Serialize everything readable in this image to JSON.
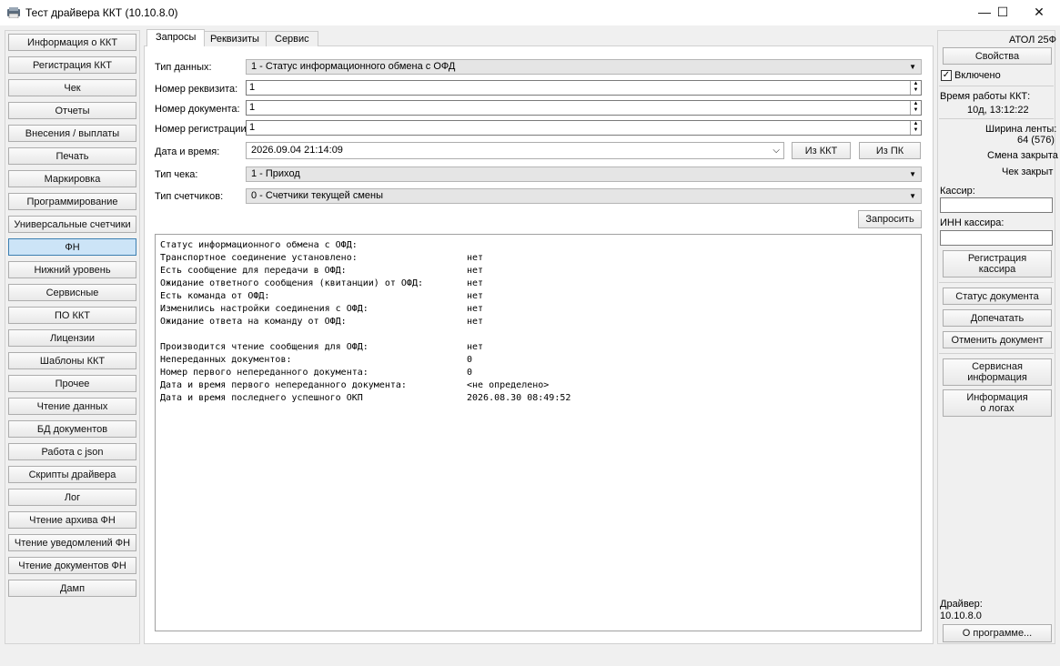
{
  "window": {
    "title": "Тест драйвера ККТ (10.10.8.0)",
    "minimize_glyph": "—",
    "maximize_glyph": "☐",
    "close_glyph": "✕"
  },
  "sidebar": {
    "items": [
      {
        "label": "Информация о ККТ"
      },
      {
        "label": "Регистрация ККТ"
      },
      {
        "label": "Чек"
      },
      {
        "label": "Отчеты"
      },
      {
        "label": "Внесения / выплаты"
      },
      {
        "label": "Печать"
      },
      {
        "label": "Маркировка"
      },
      {
        "label": "Программирование"
      },
      {
        "label": "Универсальные счетчики"
      },
      {
        "label": "ФН",
        "selected": true
      },
      {
        "label": "Нижний уровень"
      },
      {
        "label": "Сервисные"
      },
      {
        "label": "ПО ККТ"
      },
      {
        "label": "Лицензии"
      },
      {
        "label": "Шаблоны ККТ"
      },
      {
        "label": "Прочее"
      },
      {
        "label": "Чтение данных"
      },
      {
        "label": "БД документов"
      },
      {
        "label": "Работа с json"
      },
      {
        "label": "Скрипты драйвера"
      },
      {
        "label": "Лог"
      },
      {
        "label": "Чтение архива ФН"
      },
      {
        "label": "Чтение уведомлений ФН"
      },
      {
        "label": "Чтение документов ФН"
      },
      {
        "label": "Дамп"
      }
    ]
  },
  "tabs": [
    {
      "label": "Запросы",
      "active": true
    },
    {
      "label": "Реквизиты"
    },
    {
      "label": "Сервис"
    }
  ],
  "form": {
    "data_type_label": "Тип данных:",
    "data_type_value": "1 - Статус информационного обмена с ОФД",
    "requisite_label": "Номер реквизита:",
    "requisite_value": "1",
    "doc_number_label": "Номер документа:",
    "doc_number_value": "1",
    "reg_number_label": "Номер регистрации:",
    "reg_number_value": "1",
    "datetime_label": "Дата и время:",
    "datetime_value": "2026.09.04 21:14:09",
    "from_kkt_button": "Из ККТ",
    "from_pc_button": "Из ПК",
    "receipt_type_label": "Тип чека:",
    "receipt_type_value": "1 - Приход",
    "counters_type_label": "Тип счетчиков:",
    "counters_type_value": "0 - Счетчики текущей смены",
    "request_button": "Запросить"
  },
  "output": {
    "header": "Статус информационного обмена с ОФД:",
    "rows": [
      {
        "label": "Транспортное соединение установлено:",
        "value": "нет"
      },
      {
        "label": "Есть сообщение для передачи в ОФД:",
        "value": "нет"
      },
      {
        "label": "Ожидание ответного сообщения (квитанции) от ОФД:",
        "value": "нет"
      },
      {
        "label": "Есть команда от ОФД:",
        "value": "нет"
      },
      {
        "label": "Изменились настройки соединения с ОФД:",
        "value": "нет"
      },
      {
        "label": "Ожидание ответа на команду от ОФД:",
        "value": "нет"
      },
      {
        "label": "",
        "value": ""
      },
      {
        "label": "Производится чтение сообщения для ОФД:",
        "value": "нет"
      },
      {
        "label": "Непереданных документов:",
        "value": "0"
      },
      {
        "label": "Номер первого непереданного документа:",
        "value": "0"
      },
      {
        "label": "Дата и время первого непереданного документа:",
        "value": "<не определено>"
      },
      {
        "label": "Дата и время последнего успешного ОКП",
        "value": "2026.08.30 08:49:52"
      }
    ]
  },
  "right": {
    "device": "АТОЛ 25Ф",
    "properties_button": "Свойства",
    "enabled_label": "Включено",
    "enabled_check": "✓",
    "uptime_label": "Время работы ККТ:",
    "uptime_value": "10д, 13:12:22",
    "tape_label": "Ширина ленты:",
    "tape_value": "64 (576)",
    "shift_status": "Смена закрыта",
    "receipt_status": "Чек закрыт",
    "cashier_label": "Кассир:",
    "cashier_inn_label": "ИНН кассира:",
    "register_cashier_button_line1": "Регистрация",
    "register_cashier_button_line2": "кассира",
    "doc_status_button": "Статус документа",
    "reprint_button": "Допечатать",
    "cancel_doc_button": "Отменить документ",
    "service_info_line1": "Сервисная",
    "service_info_line2": "информация",
    "logs_info_line1": "Информация",
    "logs_info_line2": "о логах",
    "driver_label": "Драйвер:",
    "driver_version": "10.10.8.0",
    "about_button": "О программе..."
  }
}
